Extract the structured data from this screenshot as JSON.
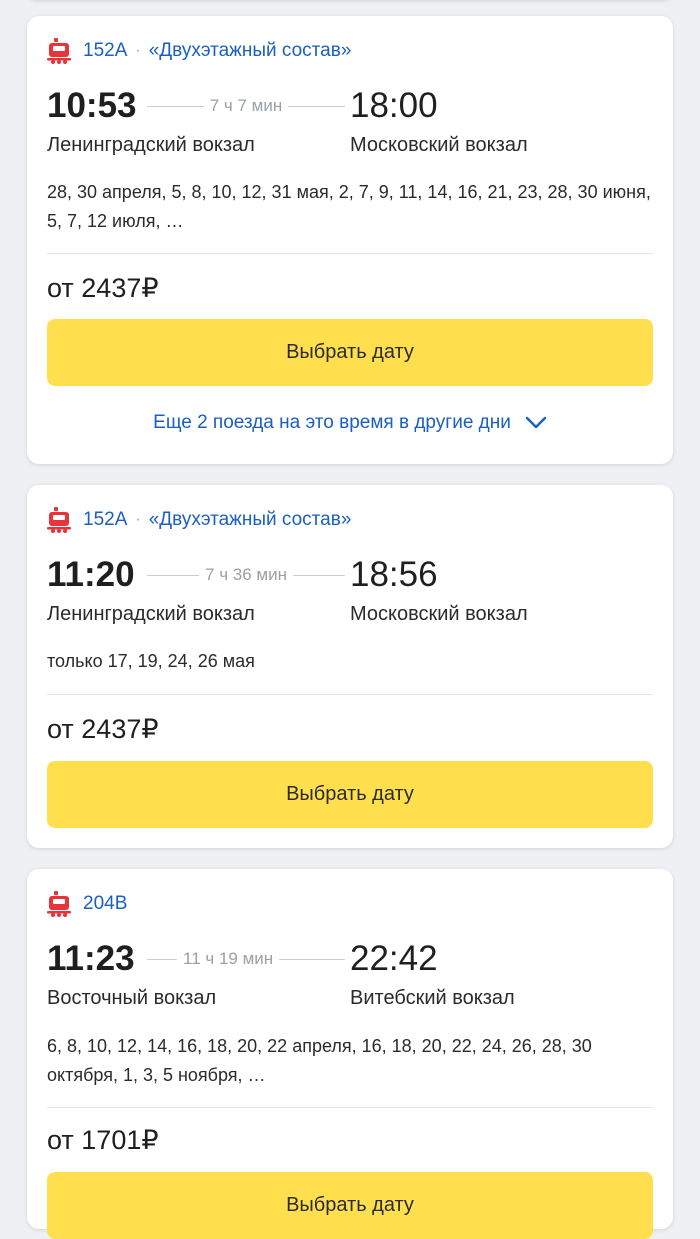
{
  "colors": {
    "accent_blue": "#1a5fc1",
    "button_yellow": "#ffdf4e",
    "train_icon_red": "#e8333a"
  },
  "trips": [
    {
      "train_number": "152А",
      "separator": "·",
      "train_name": "«Двухэтажный состав»",
      "departure_time": "10:53",
      "duration": "7 ч 7 мин",
      "arrival_time": "18:00",
      "departure_station": "Ленинградский вокзал",
      "arrival_station": "Московский вокзал",
      "dates": "28, 30 апреля, 5, 8, 10, 12, 31 мая, 2, 7, 9, 11, 14, 16, 21, 23, 28, 30 июня, 5, 7, 12 июля, …",
      "price": "от 2437₽",
      "button_label": "Выбрать дату",
      "more_link": "Еще 2 поезда на это время в другие дни"
    },
    {
      "train_number": "152А",
      "separator": "·",
      "train_name": "«Двухэтажный состав»",
      "departure_time": "11:20",
      "duration": "7 ч 36 мин",
      "arrival_time": "18:56",
      "departure_station": "Ленинградский вокзал",
      "arrival_station": "Московский вокзал",
      "dates": "только 17, 19, 24, 26 мая",
      "price": "от 2437₽",
      "button_label": "Выбрать дату"
    },
    {
      "train_number": "204В",
      "departure_time": "11:23",
      "duration": "11 ч 19 мин",
      "arrival_time": "22:42",
      "departure_station": "Восточный вокзал",
      "arrival_station": "Витебский вокзал",
      "dates": "6, 8, 10, 12, 14, 16, 18, 20, 22 апреля, 16, 18, 20, 22, 24, 26, 28, 30 октября, 1, 3, 5 ноября, …",
      "price": "от 1701₽",
      "button_label": "Выбрать дату"
    }
  ]
}
